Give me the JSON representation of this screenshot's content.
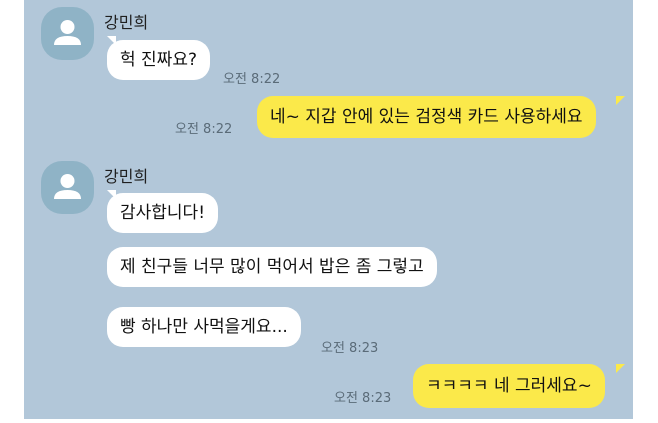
{
  "colors": {
    "chat_background": "#b2c7d9",
    "incoming_bubble": "#ffffff",
    "outgoing_bubble": "#fbe94a",
    "avatar": "#8fb3c6",
    "timestamp": "#5a6b78"
  },
  "messages": [
    {
      "id": "m1",
      "direction": "incoming",
      "sender": "강민희",
      "text": "헉 진짜요?",
      "time": "오전 8:22"
    },
    {
      "id": "m2",
      "direction": "outgoing",
      "text": "네~ 지갑 안에 있는 검정색 카드 사용하세요",
      "time": "오전 8:22"
    },
    {
      "id": "m3",
      "direction": "incoming",
      "sender": "강민희",
      "text": "감사합니다!"
    },
    {
      "id": "m4",
      "direction": "incoming",
      "text": "제 친구들 너무 많이 먹어서 밥은 좀 그렇고"
    },
    {
      "id": "m5",
      "direction": "incoming",
      "text": "빵 하나만 사먹을게요...",
      "time": "오전 8:23"
    },
    {
      "id": "m6",
      "direction": "outgoing",
      "text": "ㅋㅋㅋㅋ 네 그러세요~",
      "time": "오전 8:23"
    }
  ],
  "icons": {
    "avatar": "default-profile-person-icon"
  }
}
